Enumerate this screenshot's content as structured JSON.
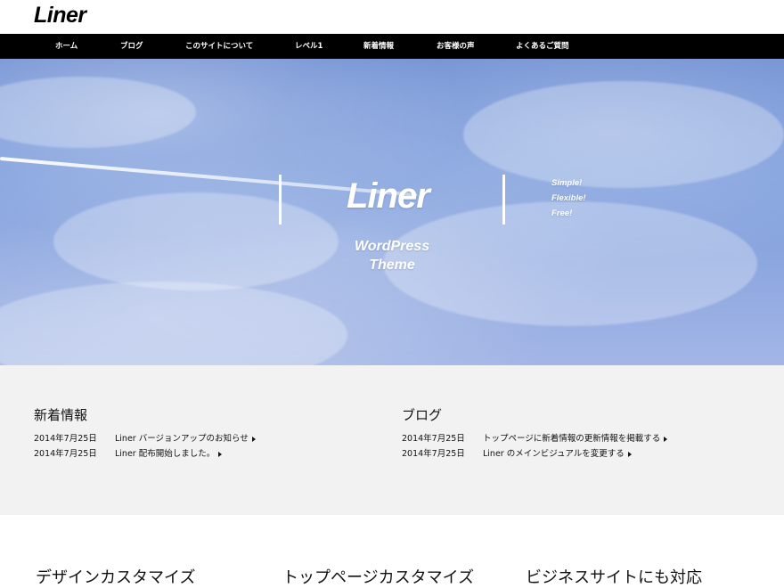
{
  "brand": {
    "logo": "Liner"
  },
  "nav": {
    "items": [
      {
        "label": "ホーム"
      },
      {
        "label": "ブログ"
      },
      {
        "label": "このサイトについて"
      },
      {
        "label": "レベル1"
      },
      {
        "label": "新着情報"
      },
      {
        "label": "お客様の声"
      },
      {
        "label": "よくあるご質問"
      }
    ]
  },
  "hero": {
    "title": "Liner",
    "subtitle_line1": "WordPress",
    "subtitle_line2": "Theme",
    "tagline": [
      "Simple!",
      "Flexible!",
      "Free!"
    ]
  },
  "news": {
    "title": "新着情報",
    "items": [
      {
        "date": "2014年7月25日",
        "title": "Liner バージョンアップのお知らせ"
      },
      {
        "date": "2014年7月25日",
        "title": "Liner 配布開始しました。"
      }
    ]
  },
  "blog": {
    "title": "ブログ",
    "items": [
      {
        "date": "2014年7月25日",
        "title": "トップページに新着情報の更新情報を掲載する"
      },
      {
        "date": "2014年7月25日",
        "title": "Liner のメインビジュアルを変更する"
      }
    ]
  },
  "features": {
    "items": [
      {
        "title": "デザインカスタマイズ"
      },
      {
        "title": "トップページカスタマイズ"
      },
      {
        "title": "ビジネスサイトにも対応"
      }
    ]
  }
}
